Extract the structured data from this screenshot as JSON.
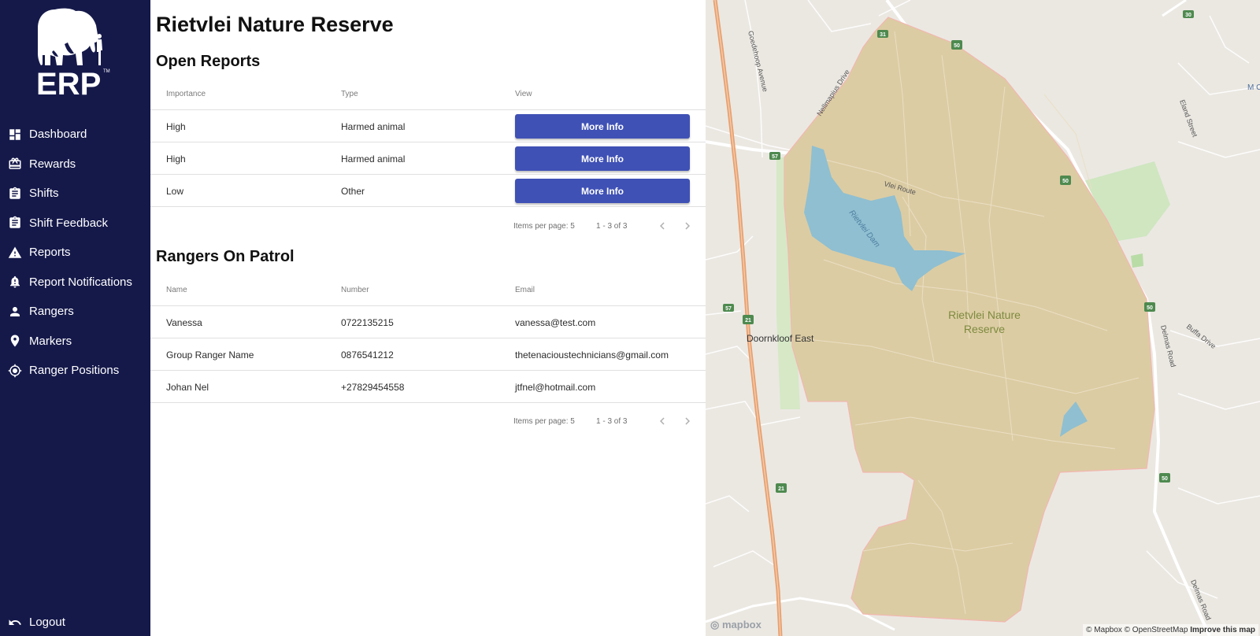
{
  "app": {
    "logo_text": "ERP",
    "logo_tm": "TM"
  },
  "sidebar": {
    "items": [
      {
        "label": "Dashboard",
        "icon": "dashboard-icon"
      },
      {
        "label": "Rewards",
        "icon": "gift-icon"
      },
      {
        "label": "Shifts",
        "icon": "clipboard-icon"
      },
      {
        "label": "Shift Feedback",
        "icon": "clipboard-icon"
      },
      {
        "label": "Reports",
        "icon": "warning-icon"
      },
      {
        "label": "Report Notifications",
        "icon": "bell-alert-icon"
      },
      {
        "label": "Rangers",
        "icon": "person-icon"
      },
      {
        "label": "Markers",
        "icon": "map-pin-icon"
      },
      {
        "label": "Ranger Positions",
        "icon": "gps-target-icon"
      }
    ],
    "logout": {
      "label": "Logout",
      "icon": "undo-icon"
    }
  },
  "main": {
    "title": "Rietvlei Nature Reserve",
    "open_reports": {
      "title": "Open Reports",
      "columns": [
        "Importance",
        "Type",
        "View"
      ],
      "rows": [
        {
          "importance": "High",
          "type": "Harmed animal",
          "action": "More Info"
        },
        {
          "importance": "High",
          "type": "Harmed animal",
          "action": "More Info"
        },
        {
          "importance": "Low",
          "type": "Other",
          "action": "More Info"
        }
      ],
      "paginator": {
        "items_per_page_label": "Items per page:",
        "items_per_page": "5",
        "range": "1 - 3 of 3"
      }
    },
    "rangers": {
      "title": "Rangers On Patrol",
      "columns": [
        "Name",
        "Number",
        "Email"
      ],
      "rows": [
        {
          "name": "Vanessa",
          "number": "0722135215",
          "email": "vanessa@test.com"
        },
        {
          "name": "Group Ranger Name",
          "number": "0876541212",
          "email": "thetenacioustechnicians@gmail.com"
        },
        {
          "name": "Johan Nel",
          "number": "+27829454558",
          "email": "jtfnel@hotmail.com"
        }
      ],
      "paginator": {
        "items_per_page_label": "Items per page:",
        "items_per_page": "5",
        "range": "1 - 3 of 3"
      }
    }
  },
  "map": {
    "reserve_label_line1": "Rietvlei Nature",
    "reserve_label_line2": "Reserve",
    "dam_label": "Rietvlei Dam",
    "suburb_label": "Doornkloof East",
    "streets": [
      "Goedehoop Avenue",
      "Nellmapius Drive",
      "Vlei Route",
      "Eland Street",
      "Buffa Drive",
      "Delmas Road",
      "Delmas Road"
    ],
    "route_shields": [
      "31",
      "30",
      "50",
      "57",
      "21",
      "57",
      "50",
      "21",
      "50",
      "50"
    ],
    "edge_label": "M C",
    "logo": "mapbox",
    "attribution": "© Mapbox © OpenStreetMap",
    "improve": "Improve this map",
    "colors": {
      "reserve": "#dccca3",
      "water": "#8fbfd1",
      "park": "#cfe6c1",
      "highway": "#e8a06f",
      "background": "#ebe8e2"
    }
  },
  "colors": {
    "sidebar": "#15194a",
    "button": "#3f51b5"
  }
}
